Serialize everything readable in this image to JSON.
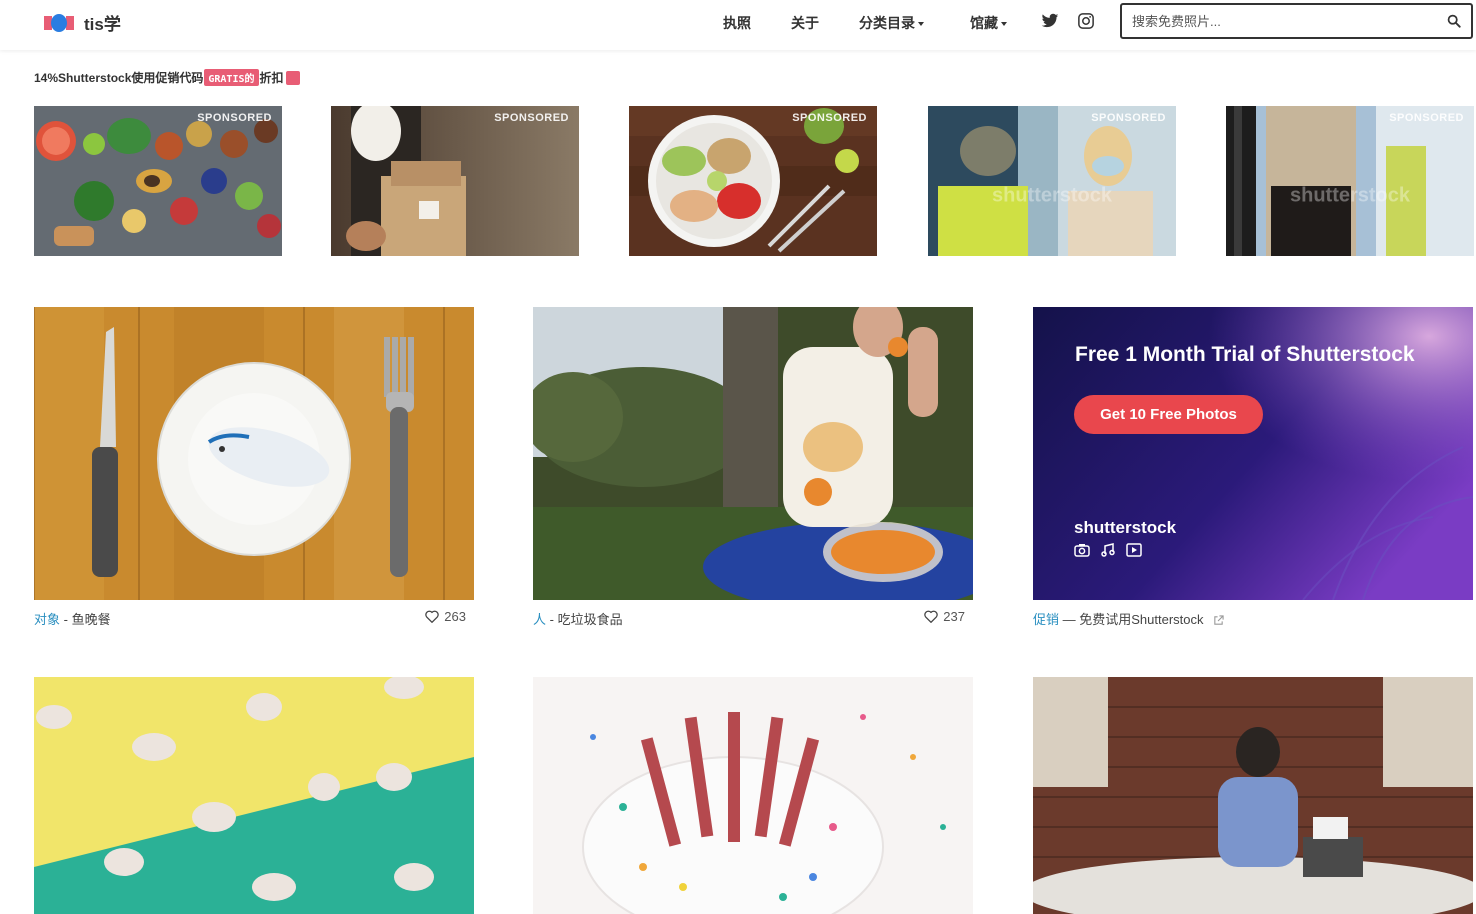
{
  "site": {
    "logo_text": "tis学"
  },
  "nav": {
    "items": [
      {
        "label": "执照",
        "dropdown": false
      },
      {
        "label": "关于",
        "dropdown": false
      },
      {
        "label": "分类目录",
        "dropdown": true
      },
      {
        "label": "馆藏",
        "dropdown": true
      }
    ],
    "social": [
      "twitter-icon",
      "instagram-icon"
    ]
  },
  "search": {
    "placeholder": "搜索免费照片..."
  },
  "promo": {
    "text_before": "14%Shutterstock使用促销代码",
    "code": "GRATIS的",
    "text_after": "折扣"
  },
  "sponsored": {
    "label": "SPONSORED",
    "watermark": "shutterstock",
    "images": [
      "vegetables-spread",
      "paper-bag-delivery",
      "salad-bowl",
      "masked-delivery",
      "door-delivery"
    ]
  },
  "cards": [
    {
      "category": "对象",
      "separator": " - ",
      "title": "鱼晚餐",
      "likes": "263"
    },
    {
      "category": "人",
      "separator": " - ",
      "title": "吃垃圾食品",
      "likes": "237"
    },
    {
      "category": "促销",
      "separator": " — ",
      "title": "免费试用Shutterstock",
      "external": true
    }
  ],
  "ad": {
    "title": "Free 1 Month Trial of Shutterstock",
    "button": "Get 10 Free Photos",
    "brand": "shutterstock"
  },
  "colors": {
    "accent_link": "#2a8fc0",
    "brand_red": "#e85d75",
    "ad_button": "#e9474d"
  }
}
